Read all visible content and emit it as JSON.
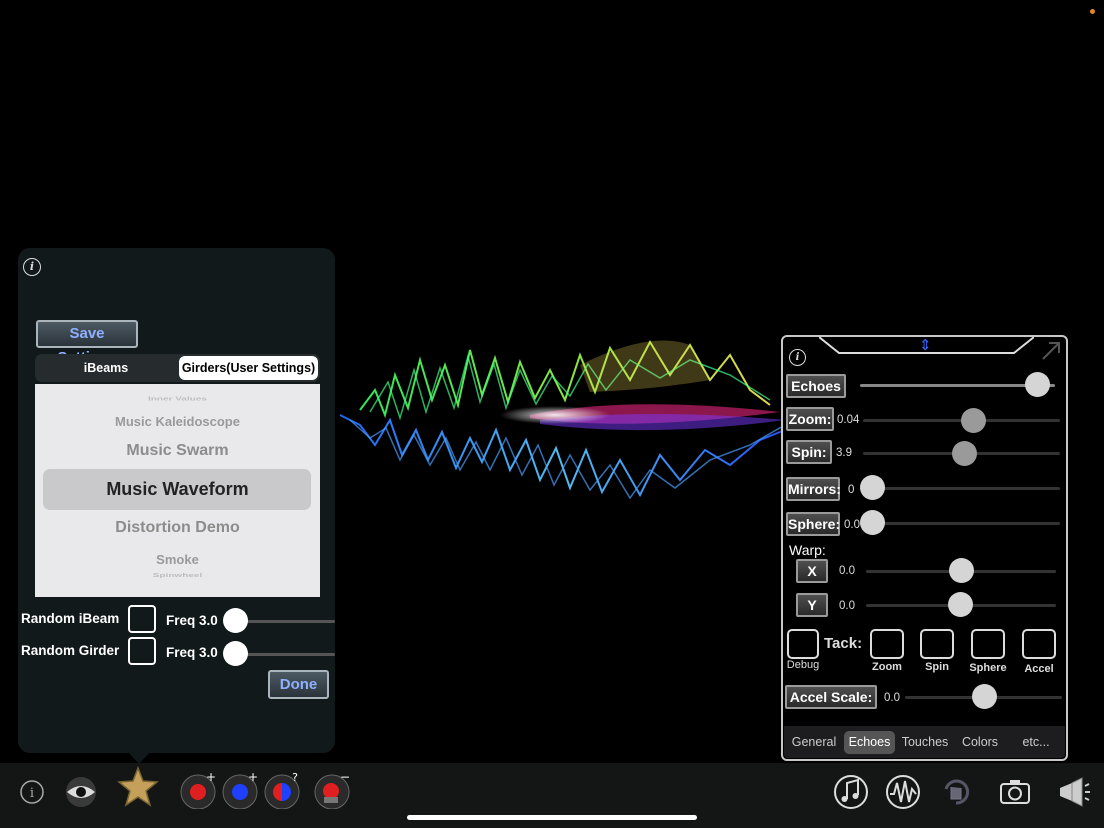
{
  "left_panel": {
    "save_label": "Save Settings",
    "segments": {
      "ibeams": "iBeams",
      "girders": "Girders(User Settings)",
      "selected": "girders"
    },
    "picker_items": [
      "Inner Values",
      "Music Kaleidoscope",
      "Music Swarm",
      "Music Waveform",
      "Distortion Demo",
      "Smoke",
      "Spinwheel"
    ],
    "selected_item": "Music Waveform",
    "random_ibeam": {
      "label": "Random iBeam",
      "checked": false,
      "freq_label": "Freq",
      "freq_value": "3.0",
      "slider_fraction": 0.0
    },
    "random_girder": {
      "label": "Random Girder",
      "checked": false,
      "freq_label": "Freq",
      "freq_value": "3.0",
      "slider_fraction": 0.0
    },
    "done_label": "Done"
  },
  "right_panel": {
    "echoes": {
      "label": "Echoes",
      "slider_fraction": 0.92
    },
    "zoom": {
      "label": "Zoom:",
      "value": "0.04",
      "slider_fraction": 0.6
    },
    "spin": {
      "label": "Spin:",
      "value": "3.9",
      "slider_fraction": 0.58
    },
    "mirrors": {
      "label": "Mirrors:",
      "value": "0",
      "slider_fraction": 0.0
    },
    "sphere": {
      "label": "Sphere:",
      "value": "0.0",
      "slider_fraction": 0.0
    },
    "warp": {
      "label": "Warp:",
      "x": {
        "label": "X",
        "value": "0.0",
        "slider_fraction": 0.5
      },
      "y": {
        "label": "Y",
        "value": "0.0",
        "slider_fraction": 0.5
      }
    },
    "debug_label": "Debug",
    "tack": {
      "label": "Tack:",
      "items": [
        "Zoom",
        "Spin",
        "Sphere",
        "Accel"
      ]
    },
    "accel_scale": {
      "label": "Accel Scale:",
      "value": "0.0",
      "slider_fraction": 0.5
    },
    "tabs": [
      "General",
      "Echoes",
      "Touches",
      "Colors",
      "etc..."
    ],
    "active_tab": "Echoes"
  },
  "toolbar": {
    "icons": [
      "info-icon",
      "eye-icon",
      "star-icon",
      "add-red-ball-icon",
      "add-blue-ball-icon",
      "random-ball-icon",
      "remove-ball-icon",
      "music-note-icon",
      "waveform-icon",
      "reset-hand-icon",
      "camera-icon",
      "megaphone-icon"
    ]
  },
  "colors": {
    "accent_blue": "#8fb0ff",
    "status_dot": "#e08a1e"
  }
}
